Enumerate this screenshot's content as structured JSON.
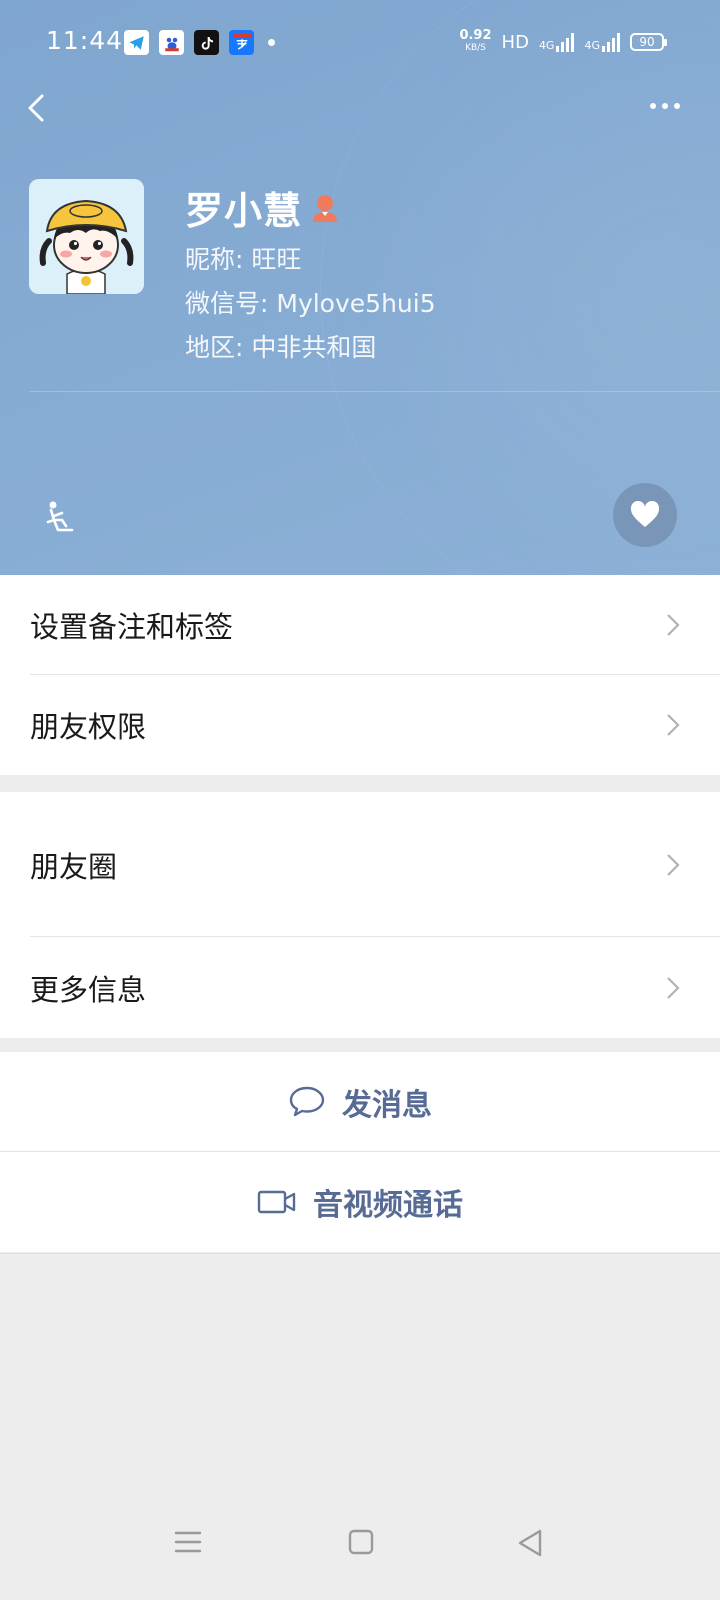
{
  "status_bar": {
    "time": "11:44",
    "speed_value": "0.92",
    "speed_unit": "KB/S",
    "hd": "HD",
    "network_1": "4G",
    "network_2": "4G",
    "battery": "90",
    "app_icons": [
      "telegram-icon",
      "baidu-icon",
      "tiktok-icon",
      "alipay-icon"
    ]
  },
  "profile": {
    "name": "罗小慧",
    "nickname_label": "昵称: ",
    "nickname": "旺旺",
    "wechat_id_label": "微信号: ",
    "wechat_id": "Mylove5hui5",
    "region_label": "地区: ",
    "region": "中非共和国",
    "gender": "female"
  },
  "menu": {
    "group1": [
      {
        "label": "设置备注和标签"
      },
      {
        "label": "朋友权限"
      }
    ],
    "group2": [
      {
        "label": "朋友圈"
      },
      {
        "label": "更多信息"
      }
    ]
  },
  "actions": {
    "send_message": "发消息",
    "av_call": "音视频通话"
  },
  "colors": {
    "header_bg": "#86abd3",
    "link_blue": "#576b95",
    "page_bg": "#ededed",
    "female_icon": "#f07a5c"
  }
}
